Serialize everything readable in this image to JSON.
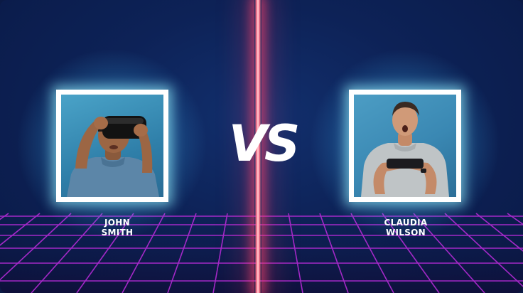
{
  "vs_label": "VS",
  "players": [
    {
      "first": "JOHN",
      "last": "SMITH"
    },
    {
      "first": "CLAUDIA",
      "last": "WILSON"
    }
  ],
  "colors": {
    "background": "#0d2257",
    "beam": "#ff6f86",
    "grid": "#b42bd6",
    "frame": "#ffffff",
    "glow": "#78f0ff"
  }
}
